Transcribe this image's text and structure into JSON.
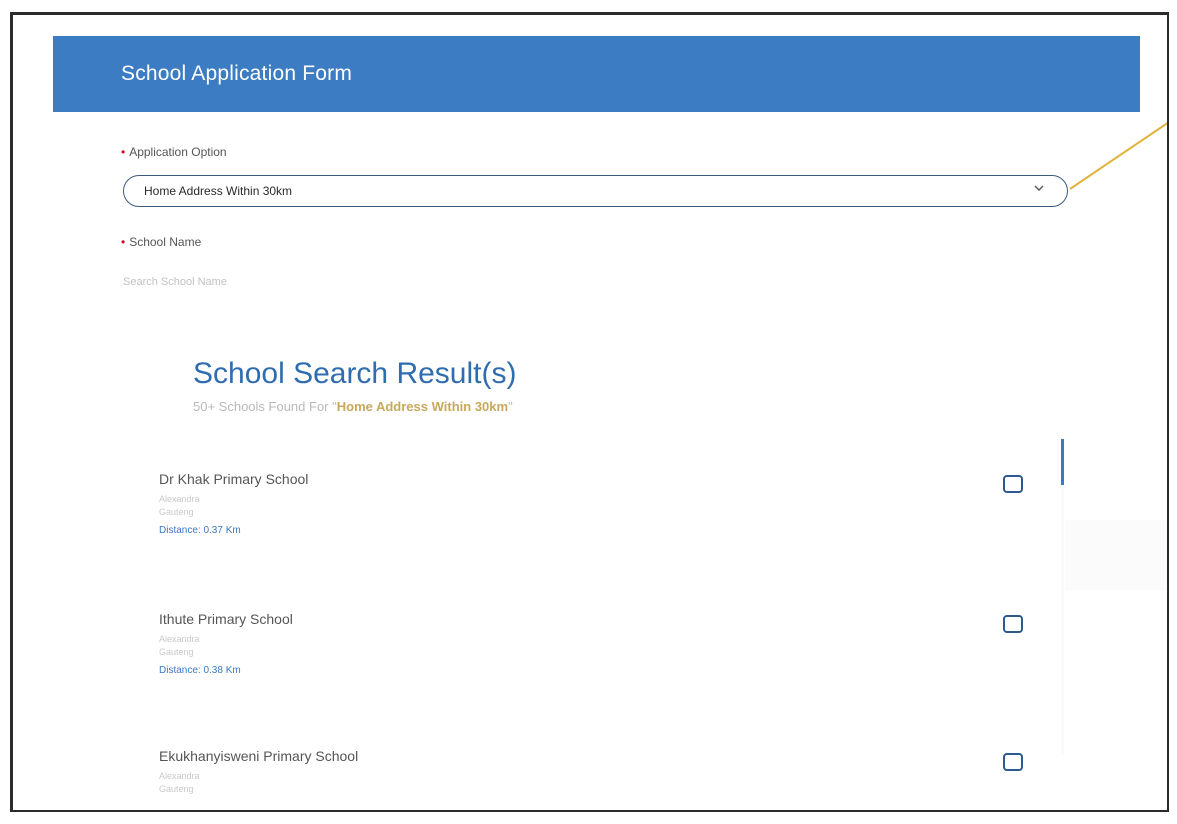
{
  "header": {
    "title": "School Application Form"
  },
  "form": {
    "application_option": {
      "label": "Application Option",
      "required_mark": "•",
      "value": "Home Address Within 30km"
    },
    "school_name": {
      "label": "School Name",
      "required_mark": "•",
      "placeholder": "Search School Name"
    }
  },
  "results": {
    "title": "School Search Result(s)",
    "subtitle_prefix": "50+ Schools Found For \"",
    "subtitle_highlight": "Home Address Within 30km",
    "subtitle_suffix": "\"",
    "schools": [
      {
        "name": "Dr Khak Primary School",
        "meta1": "Alexandra",
        "meta2": "Gauteng",
        "distance": "Distance: 0.37 Km",
        "checked": false
      },
      {
        "name": "Ithute Primary School",
        "meta1": "Alexandra",
        "meta2": "Gauteng",
        "distance": "Distance: 0.38 Km",
        "checked": false
      },
      {
        "name": "Ekukhanyisweni Primary School",
        "meta1": "Alexandra",
        "meta2": "Gauteng",
        "distance": "",
        "checked": false
      }
    ]
  },
  "colors": {
    "header_bg": "#3c7cc2",
    "accent_blue": "#2f6db0",
    "highlight_gold": "#c8a95a",
    "required_red": "#d0021b",
    "callout_line": "#e0b23a"
  },
  "icons": {
    "select_chevron": "chevron-down-icon"
  }
}
